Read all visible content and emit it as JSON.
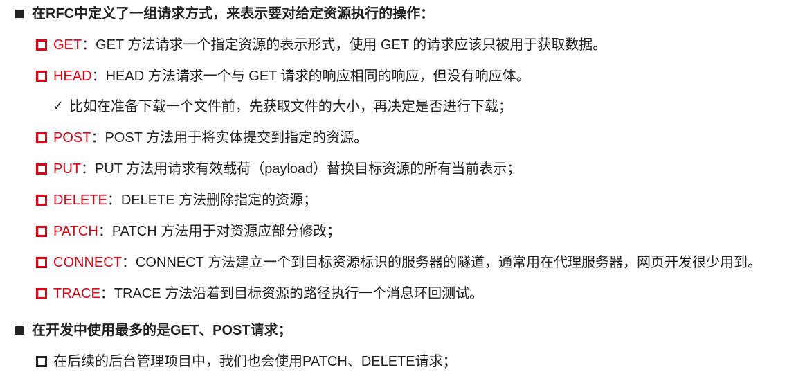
{
  "heading1": "在RFC中定义了一组请求方式，来表示要对给定资源执行的操作：",
  "methods": [
    {
      "name": "GET",
      "sep": "：",
      "desc": "GET 方法请求一个指定资源的表示形式，使用 GET 的请求应该只被用于获取数据。"
    },
    {
      "name": "HEAD",
      "sep": "：",
      "desc": "HEAD 方法请求一个与 GET 请求的响应相同的响应，但没有响应体。"
    },
    {
      "name": "POST",
      "sep": "：",
      "desc": "POST 方法用于将实体提交到指定的资源。"
    },
    {
      "name": "PUT",
      "sep": "：",
      "desc": "PUT 方法用请求有效载荷（payload）替换目标资源的所有当前表示；"
    },
    {
      "name": "DELETE",
      "sep": "：",
      "desc": "DELETE 方法删除指定的资源；"
    },
    {
      "name": "PATCH",
      "sep": "：",
      "desc": "PATCH 方法用于对资源应部分修改；"
    },
    {
      "name": "CONNECT",
      "sep": "：",
      "desc": "CONNECT 方法建立一个到目标资源标识的服务器的隧道，通常用在代理服务器，网页开发很少用到。"
    },
    {
      "name": "TRACE",
      "sep": "：",
      "desc": "TRACE 方法沿着到目标资源的路径执行一个消息环回测试。"
    }
  ],
  "head_note": "比如在准备下载一个文件前，先获取文件的大小，再决定是否进行下载；",
  "heading2": "在开发中使用最多的是GET、POST请求；",
  "note2": "在后续的后台管理项目中，我们也会使用PATCH、DELETE请求；",
  "colors": {
    "method_red": "#e60012",
    "text": "#222222"
  },
  "icons": {
    "solid_bullet": "square-filled-icon",
    "hollow_bullet": "square-outline-icon",
    "check": "checkmark-icon"
  }
}
